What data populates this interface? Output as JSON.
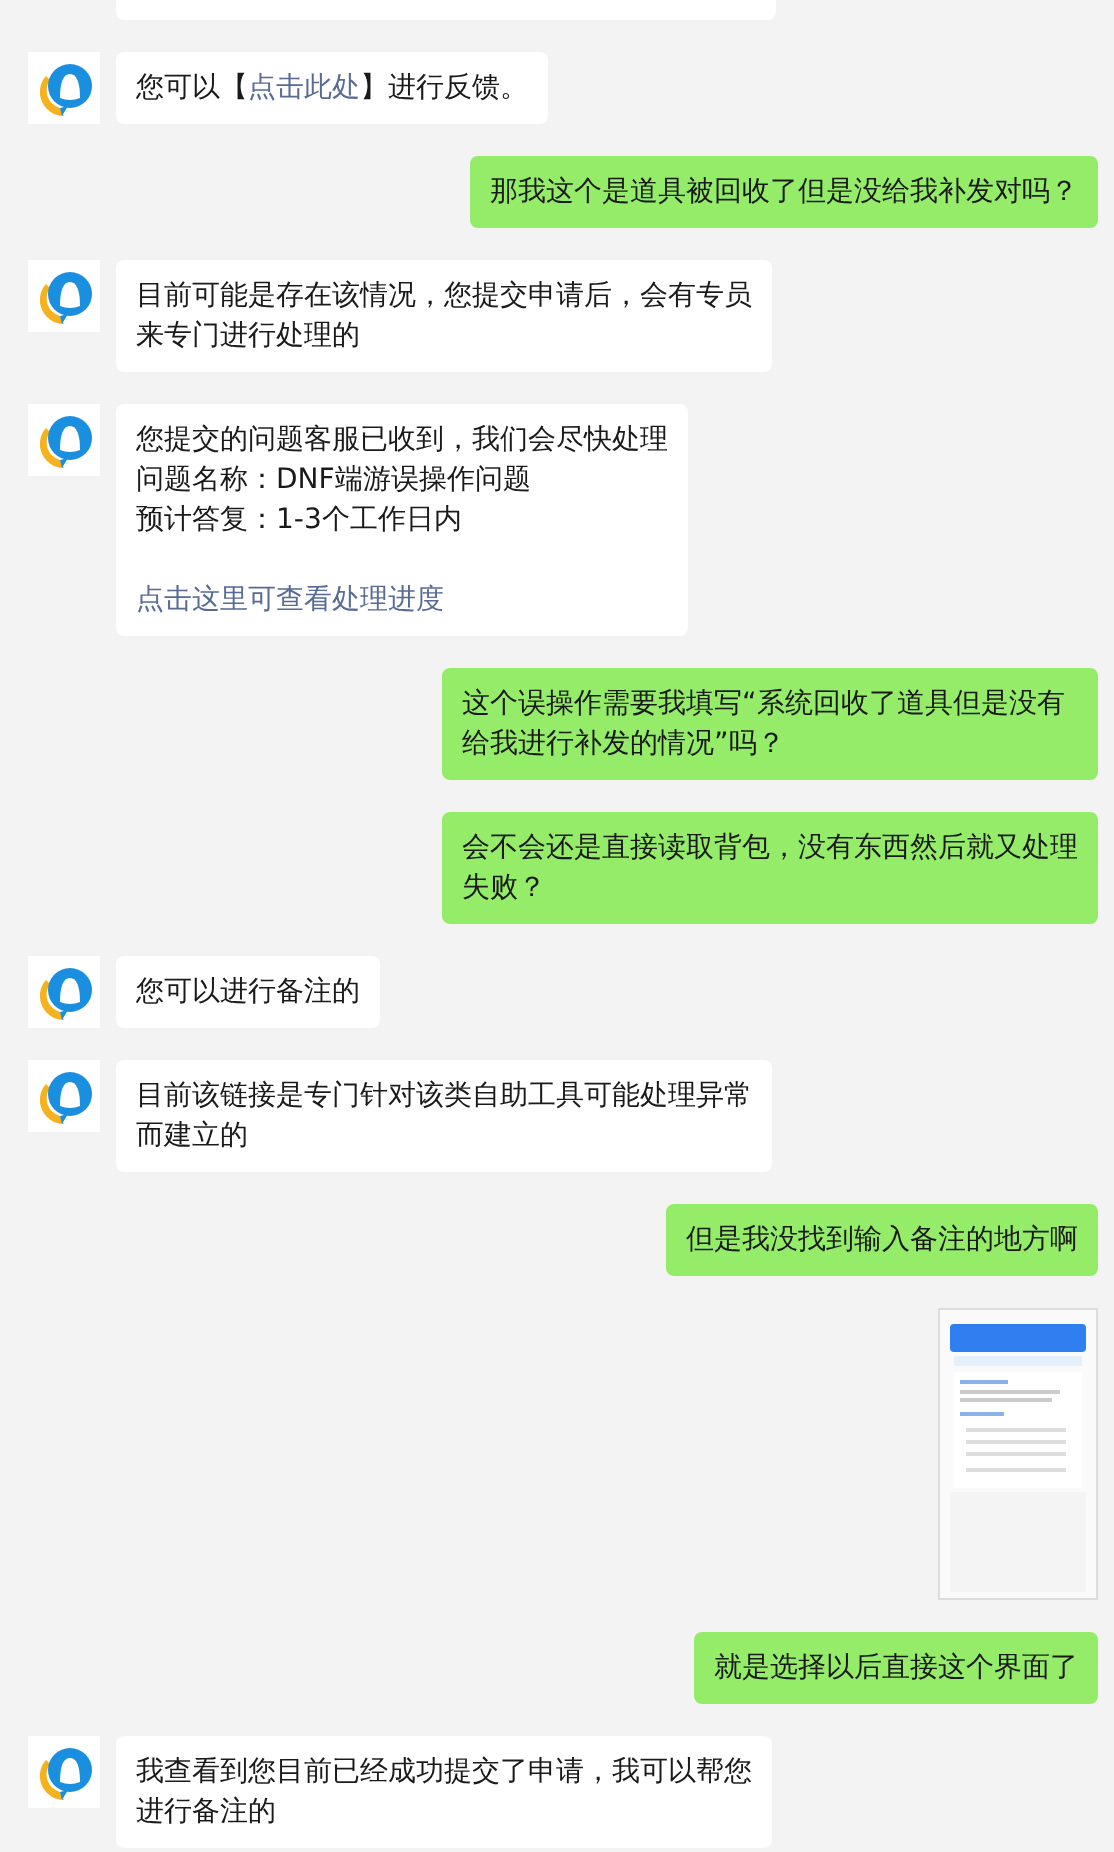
{
  "messages": [
    {
      "kind": "agent_cut"
    },
    {
      "kind": "agent_text",
      "blocks": [
        [
          [
            {
              "text": "您可以【"
            },
            {
              "text": "点击此处",
              "link": true
            },
            {
              "text": "】进行反馈。"
            }
          ]
        ]
      ]
    },
    {
      "kind": "user_text",
      "blocks": [
        [
          [
            {
              "text": "那我这个是道具被回收了但是没给我补发对吗？"
            }
          ]
        ]
      ]
    },
    {
      "kind": "agent_text",
      "blocks": [
        [
          [
            {
              "text": "目前可能是存在该情况，您提交申请后，会有专员来专门进行处理的"
            }
          ]
        ]
      ]
    },
    {
      "kind": "agent_text",
      "blocks": [
        [
          [
            {
              "text": "您提交的问题客服已收到，我们会尽快处理"
            }
          ],
          [
            {
              "text": "问题名称：DNF端游误操作问题"
            }
          ],
          [
            {
              "text": "预计答复：1-3个工作日内"
            }
          ]
        ],
        [
          [
            {
              "text": "点击这里可查看处理进度",
              "link": true
            }
          ]
        ]
      ]
    },
    {
      "kind": "user_text",
      "blocks": [
        [
          [
            {
              "text": "这个误操作需要我填写“系统回收了道具但是没有给我进行补发的情况”吗？"
            }
          ]
        ]
      ]
    },
    {
      "kind": "user_text",
      "blocks": [
        [
          [
            {
              "text": "会不会还是直接读取背包，没有东西然后就又处理失败？"
            }
          ]
        ]
      ]
    },
    {
      "kind": "agent_text",
      "blocks": [
        [
          [
            {
              "text": "您可以进行备注的"
            }
          ]
        ]
      ]
    },
    {
      "kind": "agent_text",
      "blocks": [
        [
          [
            {
              "text": "目前该链接是专门针对该类自助工具可能处理异常而建立的"
            }
          ]
        ]
      ]
    },
    {
      "kind": "user_text",
      "blocks": [
        [
          [
            {
              "text": "但是我没找到输入备注的地方啊"
            }
          ]
        ]
      ]
    },
    {
      "kind": "user_image"
    },
    {
      "kind": "user_text",
      "blocks": [
        [
          [
            {
              "text": "就是选择以后直接这个界面了"
            }
          ]
        ]
      ]
    },
    {
      "kind": "agent_text",
      "blocks": [
        [
          [
            {
              "text": "我查看到您目前已经成功提交了申请，我可以帮您进行备注的"
            }
          ]
        ]
      ]
    }
  ]
}
